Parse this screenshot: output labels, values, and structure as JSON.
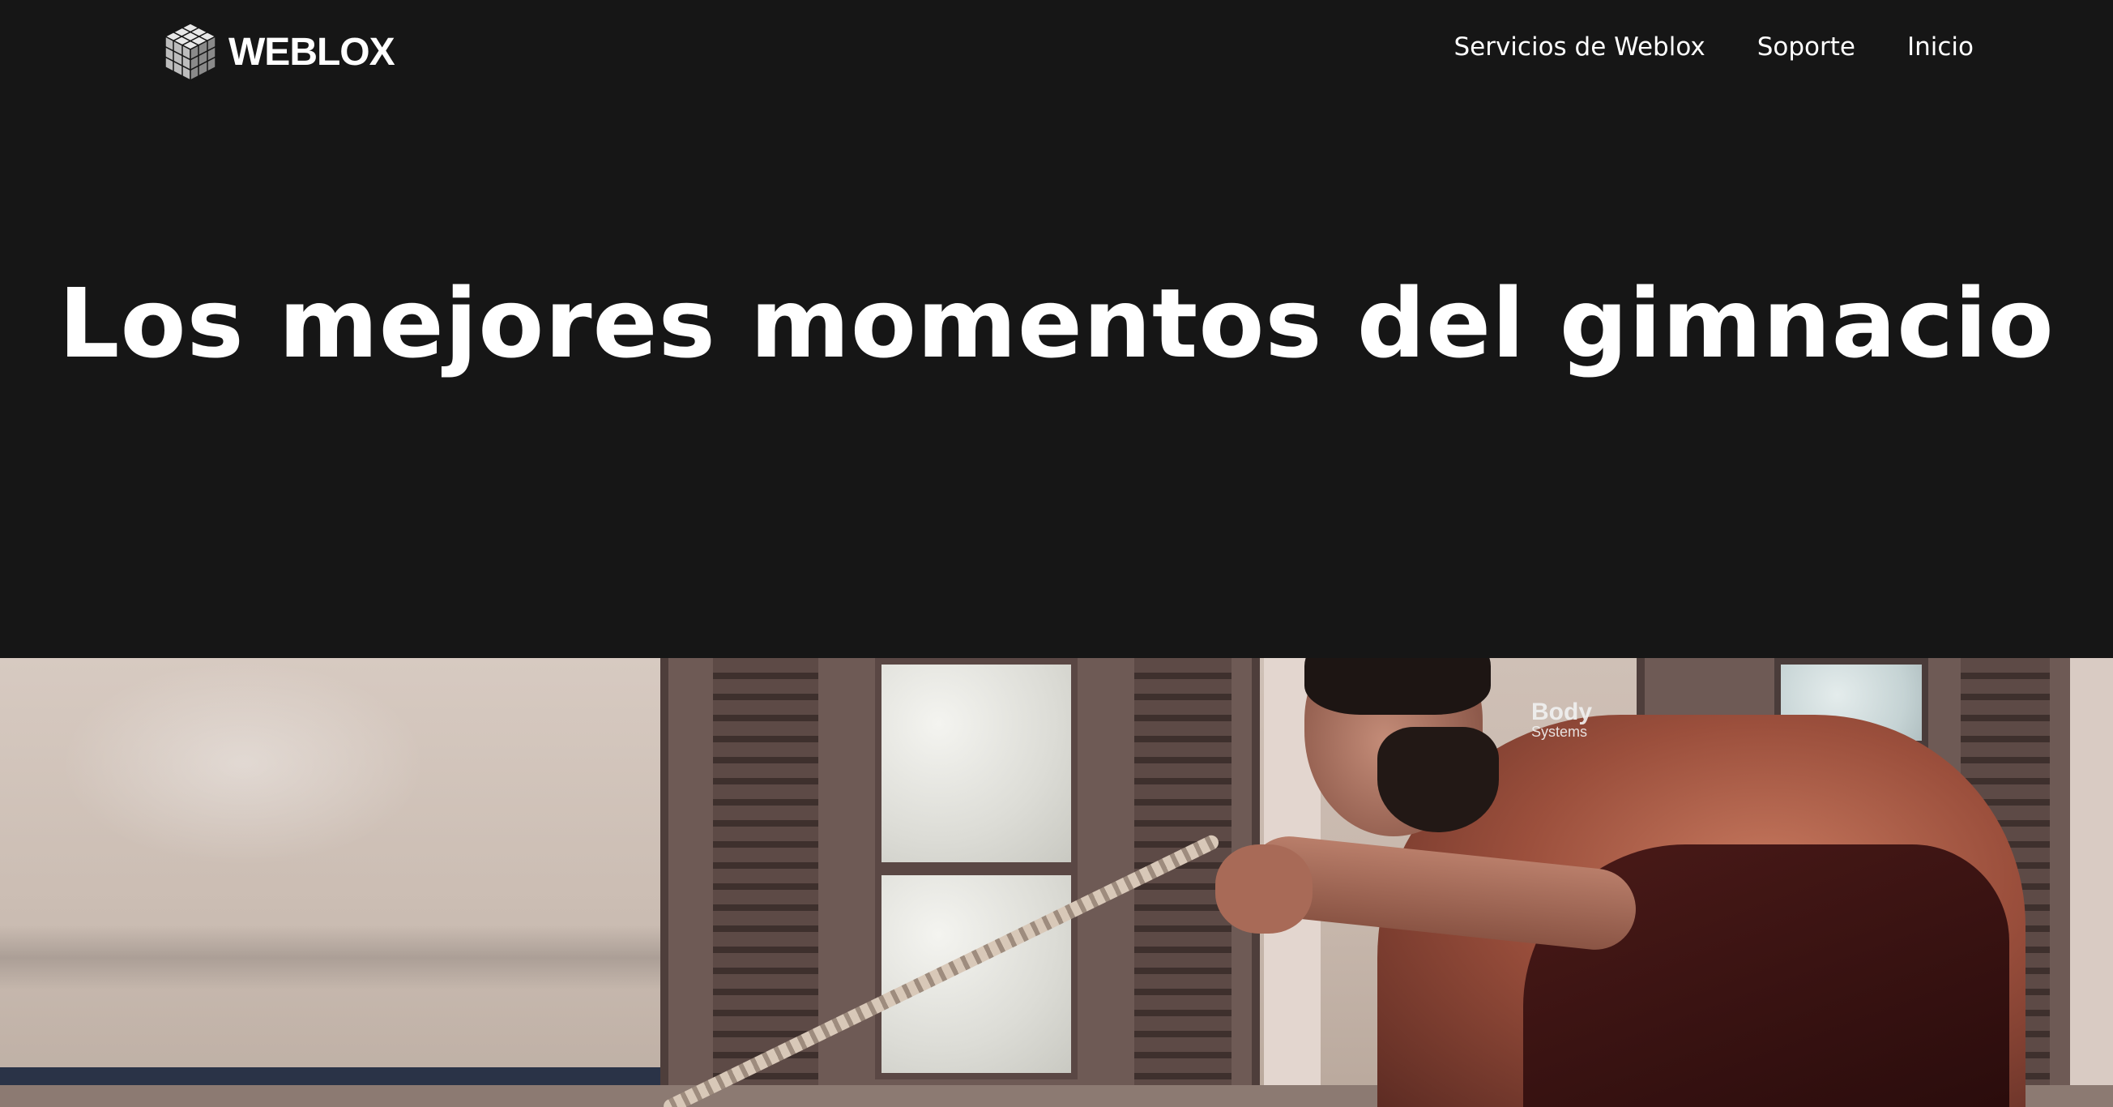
{
  "brand": {
    "name": "WEBLOX",
    "logo_icon": "cube-grid-icon"
  },
  "nav": {
    "items": [
      {
        "label": "Servicios de Weblox"
      },
      {
        "label": "Soporte"
      },
      {
        "label": "Inicio"
      }
    ]
  },
  "hero": {
    "title": "Los mejores momentos del gimnacio"
  },
  "photo": {
    "wall_logo_title": "Body",
    "wall_logo_sub": "Systems"
  },
  "colors": {
    "background": "#161616",
    "text": "#ffffff"
  }
}
